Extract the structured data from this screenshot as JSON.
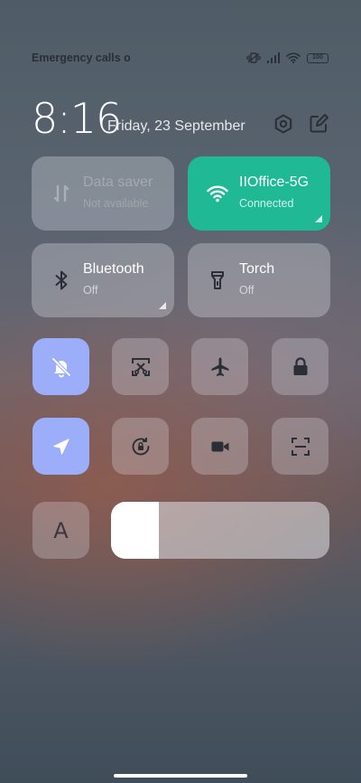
{
  "status": {
    "carrier_text": "Emergency calls o",
    "battery": "100"
  },
  "header": {
    "time": "8:16",
    "date": "Friday, 23 September"
  },
  "tiles": [
    {
      "title": "Data saver",
      "subtitle": "Not available",
      "icon": "data-saver-icon",
      "state": "unavailable"
    },
    {
      "title": "IIOffice-5G",
      "subtitle": "Connected",
      "icon": "wifi-icon",
      "state": "on"
    },
    {
      "title": "Bluetooth",
      "subtitle": "Off",
      "icon": "bluetooth-icon",
      "state": "off"
    },
    {
      "title": "Torch",
      "subtitle": "Off",
      "icon": "torch-icon",
      "state": "off"
    }
  ],
  "quick_toggles": [
    {
      "icon": "silent-icon",
      "active": true
    },
    {
      "icon": "screenshot-icon",
      "active": false
    },
    {
      "icon": "airplane-icon",
      "active": false
    },
    {
      "icon": "lock-icon",
      "active": false
    },
    {
      "icon": "location-icon",
      "active": true
    },
    {
      "icon": "rotation-lock-icon",
      "active": false
    },
    {
      "icon": "screen-recorder-icon",
      "active": false
    },
    {
      "icon": "scanner-icon",
      "active": false
    }
  ],
  "font_button_label": "A",
  "brightness": {
    "fraction": 0.22
  },
  "colors": {
    "wifi_active": "#1fb995",
    "toggle_active": "#9caefa"
  }
}
